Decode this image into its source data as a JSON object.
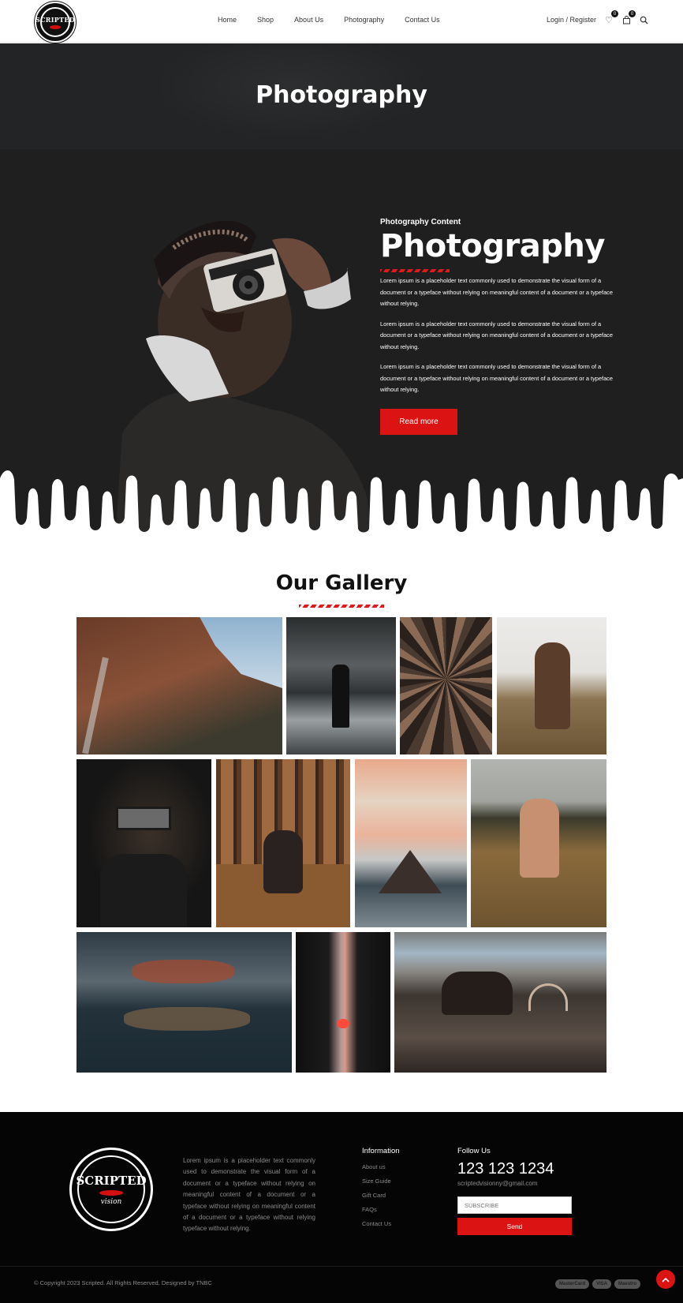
{
  "header": {
    "logo_text": "SCRIPTED",
    "nav": [
      "Home",
      "Shop",
      "About Us",
      "Photography",
      "Contact Us"
    ],
    "login_label": "Login / Register",
    "wishlist_count": "0",
    "cart_count": "0"
  },
  "banner": {
    "title": "Photography"
  },
  "hero": {
    "kicker": "Photography Content",
    "title": "Photography",
    "paragraphs": [
      "Lorem ipsum is a placeholder text commonly used to demonstrate the visual form of a document or a typeface without relying on meaningful content of a document or a typeface without relying.",
      "Lorem ipsum is a placeholder text commonly used to demonstrate the visual form of a document or a typeface without relying on meaningful content of a document or a typeface without relying.",
      "Lorem ipsum is a placeholder text commonly used to demonstrate the visual form of a document or a typeface without relying on meaningful content of a document or a typeface without relying."
    ],
    "button_label": "Read more"
  },
  "gallery": {
    "title": "Our Gallery"
  },
  "footer": {
    "logo_text": "SCRIPTED",
    "logo_sub": "vision",
    "about": "Lorem ipsum is a placeholder text commonly used to demonstrate the visual form of a document or a typeface without relying on meaningful content of a document or a typeface without relying on meaningful content of a document or a typeface without relying typeface without relying.",
    "info_heading": "Information",
    "links": [
      "About us",
      "Size Guide ",
      "Gift Card ",
      "FAQs",
      "Contact Us"
    ],
    "follow_heading": "Follow Us",
    "phone": "123 123 1234",
    "email": "scriptedvisionny@gmail.com",
    "subscribe_placeholder": "SUBSCRIBE",
    "send_label": "Send",
    "copyright": "© Copyright 2023 Scripted. All Rights Reserved. Designed by TNBC",
    "payments": [
      "MasterCard",
      "VISA",
      "Maestro"
    ]
  },
  "colors": {
    "accent": "#dc1313",
    "dark": "#1f1f20",
    "footer": "#050505"
  }
}
